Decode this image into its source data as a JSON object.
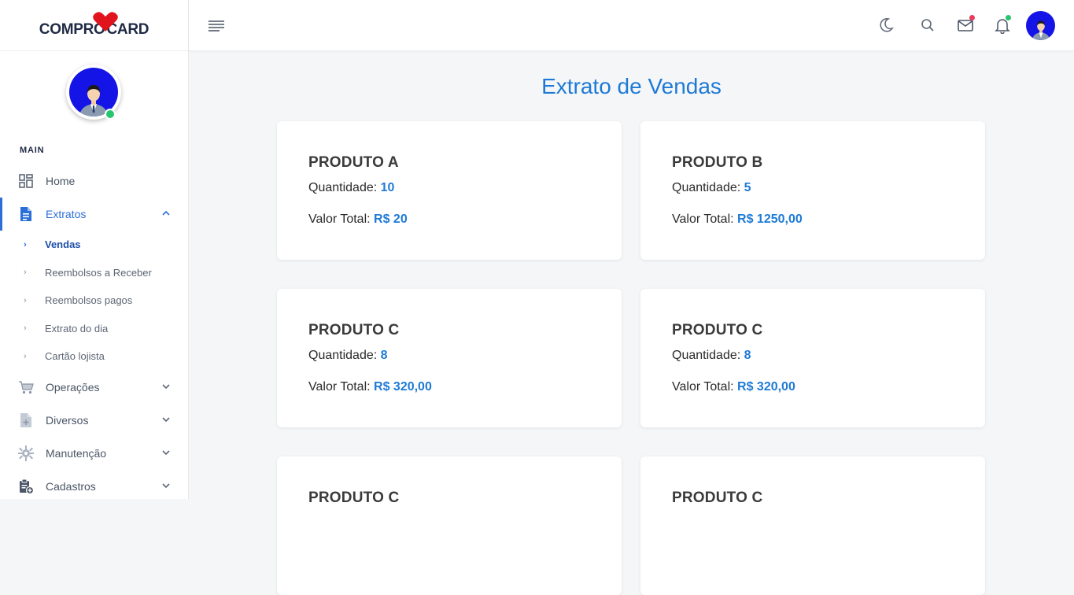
{
  "brand": {
    "name_left": "COMPRO",
    "name_right": "CARD",
    "heart_color": "#e1141e"
  },
  "sidebar": {
    "caption": "MAIN",
    "items": [
      {
        "label": "Home",
        "icon": "dashboard-icon"
      },
      {
        "label": "Extratos",
        "icon": "document-icon",
        "expanded": true
      },
      {
        "label": "Operações",
        "icon": "cart-icon"
      },
      {
        "label": "Diversos",
        "icon": "file-add-icon"
      },
      {
        "label": "Manutenção",
        "icon": "gear-icon"
      },
      {
        "label": "Cadastros",
        "icon": "clipboard-add-icon"
      }
    ],
    "subitems": [
      {
        "label": "Vendas",
        "current": true
      },
      {
        "label": "Reembolsos a Receber"
      },
      {
        "label": "Reembolsos pagos"
      },
      {
        "label": "Extrato do dia"
      },
      {
        "label": "Cartão lojista"
      }
    ]
  },
  "header": {
    "icons": [
      "menu-icon",
      "moon-icon",
      "search-icon",
      "mail-icon",
      "bell-icon",
      "avatar"
    ],
    "mail_badge_color": "#ea3b5a",
    "bell_badge_color": "#28c76f"
  },
  "main": {
    "title": "Extrato de Vendas",
    "quantity_label": "Quantidade:",
    "total_label": "Valor Total:",
    "cards": [
      {
        "name": "PRODUTO A",
        "quantity": "10",
        "total": "R$ 20"
      },
      {
        "name": "PRODUTO B",
        "quantity": "5",
        "total": "R$ 1250,00"
      },
      {
        "name": "PRODUTO C",
        "quantity": "8",
        "total": "R$ 320,00"
      },
      {
        "name": "PRODUTO C",
        "quantity": "8",
        "total": "R$ 320,00"
      },
      {
        "name": "PRODUTO C",
        "quantity": "",
        "total": ""
      },
      {
        "name": "PRODUTO C",
        "quantity": "",
        "total": ""
      }
    ]
  },
  "colors": {
    "accent": "#1e7ad6",
    "online": "#28c76f"
  }
}
